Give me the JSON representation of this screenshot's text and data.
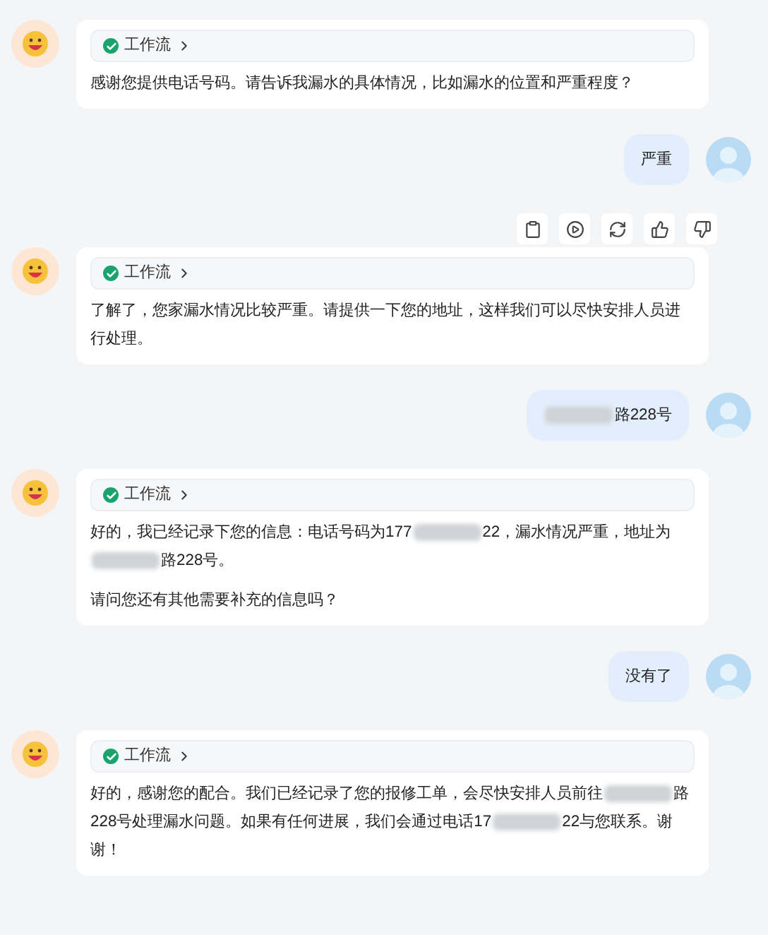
{
  "messages": [
    {
      "kind": "bot",
      "workflow": {
        "label": "工作流",
        "done": true
      },
      "paragraphs": [
        [
          {
            "kind": "text",
            "text": "感谢您提供电话号码。请告诉我漏水的具体情况，比如漏水的位置和严重程度？"
          }
        ]
      ]
    },
    {
      "kind": "user",
      "paragraphs": [
        [
          {
            "kind": "text",
            "text": "严重"
          }
        ]
      ]
    },
    {
      "kind": "bot",
      "toolbar": [
        {
          "kind": "copy"
        },
        {
          "kind": "play"
        },
        {
          "kind": "regenerate"
        },
        {
          "kind": "like"
        },
        {
          "kind": "dislike"
        }
      ],
      "workflow": {
        "label": "工作流",
        "done": true
      },
      "paragraphs": [
        [
          {
            "kind": "text",
            "text": "了解了，您家漏水情况比较严重。请提供一下您的地址，这样我们可以尽快安排人员进行处理。"
          }
        ]
      ]
    },
    {
      "kind": "user",
      "paragraphs": [
        [
          {
            "kind": "redacted"
          },
          {
            "kind": "text",
            "text": "路228号"
          }
        ]
      ]
    },
    {
      "kind": "bot",
      "workflow": {
        "label": "工作流",
        "done": true
      },
      "paragraphs": [
        [
          {
            "kind": "text",
            "text": "好的，我已经记录下您的信息：电话号码为177"
          },
          {
            "kind": "redacted"
          },
          {
            "kind": "text",
            "text": "22，漏水情况严重，地址为"
          },
          {
            "kind": "redacted"
          },
          {
            "kind": "text",
            "text": "路228号。"
          }
        ],
        [
          {
            "kind": "text",
            "text": "请问您还有其他需要补充的信息吗？"
          }
        ]
      ]
    },
    {
      "kind": "user",
      "paragraphs": [
        [
          {
            "kind": "text",
            "text": "没有了"
          }
        ]
      ]
    },
    {
      "kind": "bot",
      "workflow": {
        "label": "工作流",
        "done": true
      },
      "paragraphs": [
        [
          {
            "kind": "text",
            "text": "好的，感谢您的配合。我们已经记录了您的报修工单，会尽快安排人员前往"
          },
          {
            "kind": "redacted"
          },
          {
            "kind": "text",
            "text": "路228号处理漏水问题。如果有任何进展，我们会通过电话17"
          },
          {
            "kind": "redacted"
          },
          {
            "kind": "text",
            "text": "22与您联系。谢谢！"
          }
        ]
      ]
    }
  ]
}
